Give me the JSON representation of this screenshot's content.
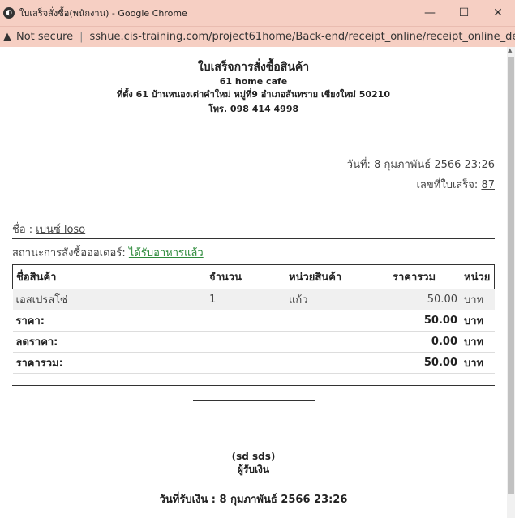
{
  "window": {
    "title": "ใบเสร็จสั่งซื้อ(พนักงาน) - Google Chrome",
    "minimize": "—",
    "maximize": "☐",
    "close": "✕"
  },
  "address": {
    "security": "Not secure",
    "url": "sshue.cis-training.com/project61home/Back-end/receipt_online/receipt_online_de..."
  },
  "receipt": {
    "title": "ใบเสร็จการสั่งซื้อสินค้า",
    "shop": "61 home cafe",
    "address": "ที่ตั้ง 61 บ้านหนองเต่าคำใหม่ หมู่ที่9 อำเภอสันทราย เชียงใหม่ 50210",
    "phone": "โทร. 098 414 4998",
    "date_label": "วันที่:",
    "date_value": "8 กุมภาพันธ์ 2566 23:26",
    "receipt_no_label": "เลขที่ใบเสร็จ:",
    "receipt_no": "87",
    "name_label": "ชื่อ :",
    "name_value": "เบนซ์ loso",
    "status_label": "สถานะการสั่งซื้อออเดอร์:",
    "status_value": "ได้รับอาหารแล้ว",
    "headers": {
      "product": "ชื่อสินค้า",
      "qty": "จำนวน",
      "unit": "หน่วยสินค้า",
      "total": "ราคารวม",
      "currency_unit": "หน่วย"
    },
    "item": {
      "product": "เอสเปรสโซ่",
      "qty": "1",
      "unit": "แก้ว",
      "total": "50.00",
      "currency": "บาท"
    },
    "price_label": "ราคา:",
    "price_value": "50.00",
    "discount_label": "ลดราคา:",
    "discount_value": "0.00",
    "grand_label": "ราคารวม:",
    "grand_value": "50.00",
    "currency": "บาท",
    "signer": "(sd sds)",
    "receiver_label": "ผู้รับเงิน",
    "received_date": "วันที่รับเงิน : 8 กุมภาพันธ์ 2566 23:26"
  }
}
